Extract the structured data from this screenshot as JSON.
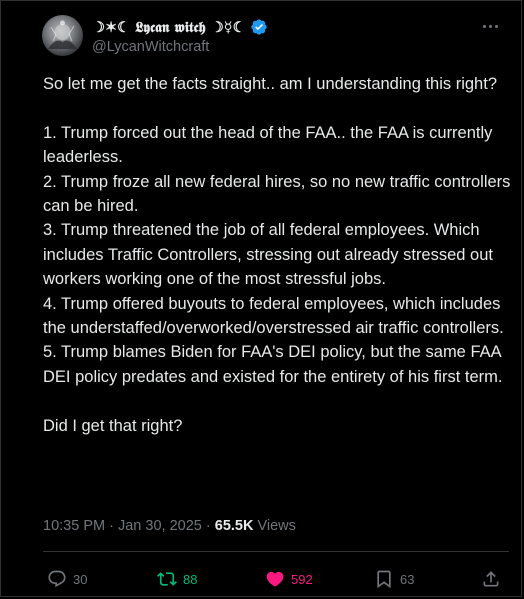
{
  "author": {
    "display_name": "☽✶☾ 𝕷𝖞𝖈𝖆𝖓 𝖜𝖎𝖙𝖈𝖍 ☽☿☾",
    "handle": "@LycanWitchcraft",
    "verified": true
  },
  "tweet": {
    "paragraphs": [
      "So let me get the facts straight.. am I understanding this right?",
      "",
      "1. Trump forced out the head of the FAA.. the FAA is currently leaderless.",
      "2. Trump froze all new federal hires, so no new traffic controllers can be hired.",
      "3. Trump threatened the job of all federal employees. Which includes Traffic Controllers, stressing out already stressed out workers working one of the most stressful jobs.",
      "4. Trump offered buyouts to federal employees, which includes the understaffed/overworked/overstressed air traffic controllers.",
      "5. Trump blames Biden for FAA's DEI policy, but the same FAA DEI policy predates and existed for the entirety of his first term.",
      "",
      "Did I get that right?"
    ]
  },
  "meta": {
    "time": "10:35 PM",
    "separator": "·",
    "date": "Jan 30, 2025",
    "views_count": "65.5K",
    "views_label": "Views"
  },
  "actions": {
    "replies": "30",
    "reposts": "88",
    "likes": "592",
    "bookmarks": "63"
  },
  "colors": {
    "background": "#000000",
    "text": "#e7e9ea",
    "muted": "#71767b",
    "verified": "#1d9bf0",
    "repost": "#00ba7c",
    "like": "#f91880"
  }
}
